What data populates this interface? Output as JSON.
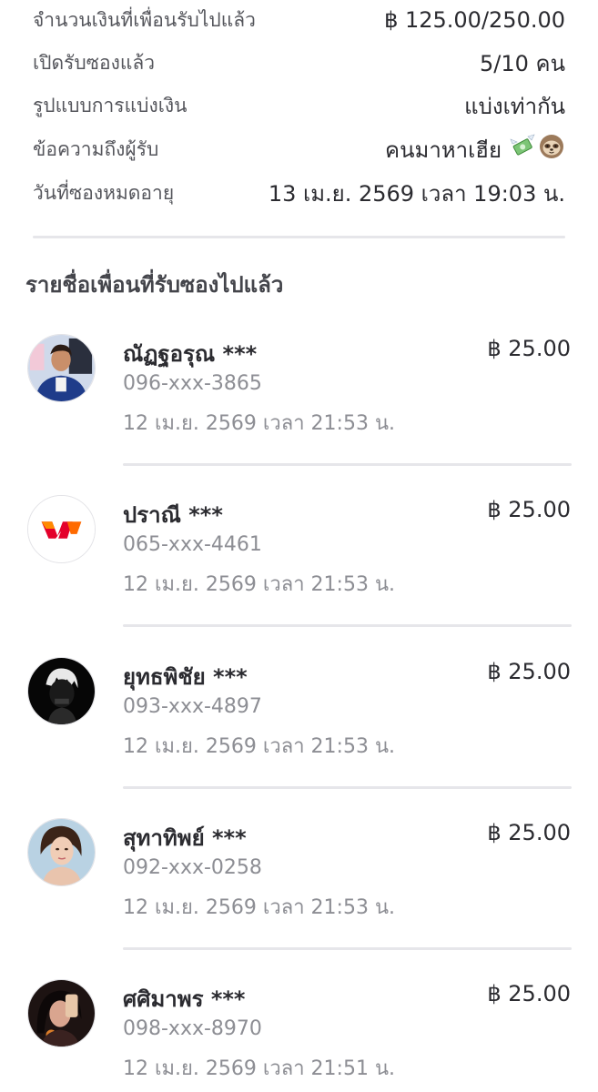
{
  "summary": {
    "amount_label": "จำนวนเงินที่เพื่อนรับไปแล้ว",
    "amount_value": "฿ 125.00/250.00",
    "opened_label": "เปิดรับซองแล้ว",
    "opened_value": "5/10 คน",
    "split_label": "รูปแบบการแบ่งเงิน",
    "split_value": "แบ่งเท่ากัน",
    "message_label": "ข้อความถึงผู้รับ",
    "message_value": "คนมาหาเฮีย",
    "message_emojis": [
      "money-with-wings-icon",
      "sloth-icon"
    ],
    "expiry_label": "วันที่ซองหมดอายุ",
    "expiry_value": "13 เม.ย. 2569 เวลา 19:03 น."
  },
  "section_title": "รายชื่อเพื่อนที่รับซองไปแล้ว",
  "recipients": [
    {
      "name": "ณัฏฐอรุณ ***",
      "phone": "096-xxx-3865",
      "time": "12 เม.ย. 2569 เวลา 21:53 น.",
      "amount": "฿ 25.00",
      "avatar": "photo-man"
    },
    {
      "name": "ปราณี ***",
      "phone": "065-xxx-4461",
      "time": "12 เม.ย. 2569 เวลา 21:53 น.",
      "amount": "฿ 25.00",
      "avatar": "truemoney-logo"
    },
    {
      "name": "ยุทธพิชัย ***",
      "phone": "093-xxx-4897",
      "time": "12 เม.ย. 2569 เวลา 21:53 น.",
      "amount": "฿ 25.00",
      "avatar": "anime-dark"
    },
    {
      "name": "สุทาทิพย์ ***",
      "phone": "092-xxx-0258",
      "time": "12 เม.ย. 2569 เวลา 21:53 น.",
      "amount": "฿ 25.00",
      "avatar": "photo-woman"
    },
    {
      "name": "ศศิมาพร ***",
      "phone": "098-xxx-8970",
      "time": "12 เม.ย. 2569 เวลา 21:51 น.",
      "amount": "฿ 25.00",
      "avatar": "photo-selfie"
    }
  ],
  "colors": {
    "text_primary": "#2b2b30",
    "text_secondary": "#8d8e94",
    "divider": "#e6e6ea",
    "brand_orange": "#ff6a00",
    "brand_red": "#e4002b"
  }
}
